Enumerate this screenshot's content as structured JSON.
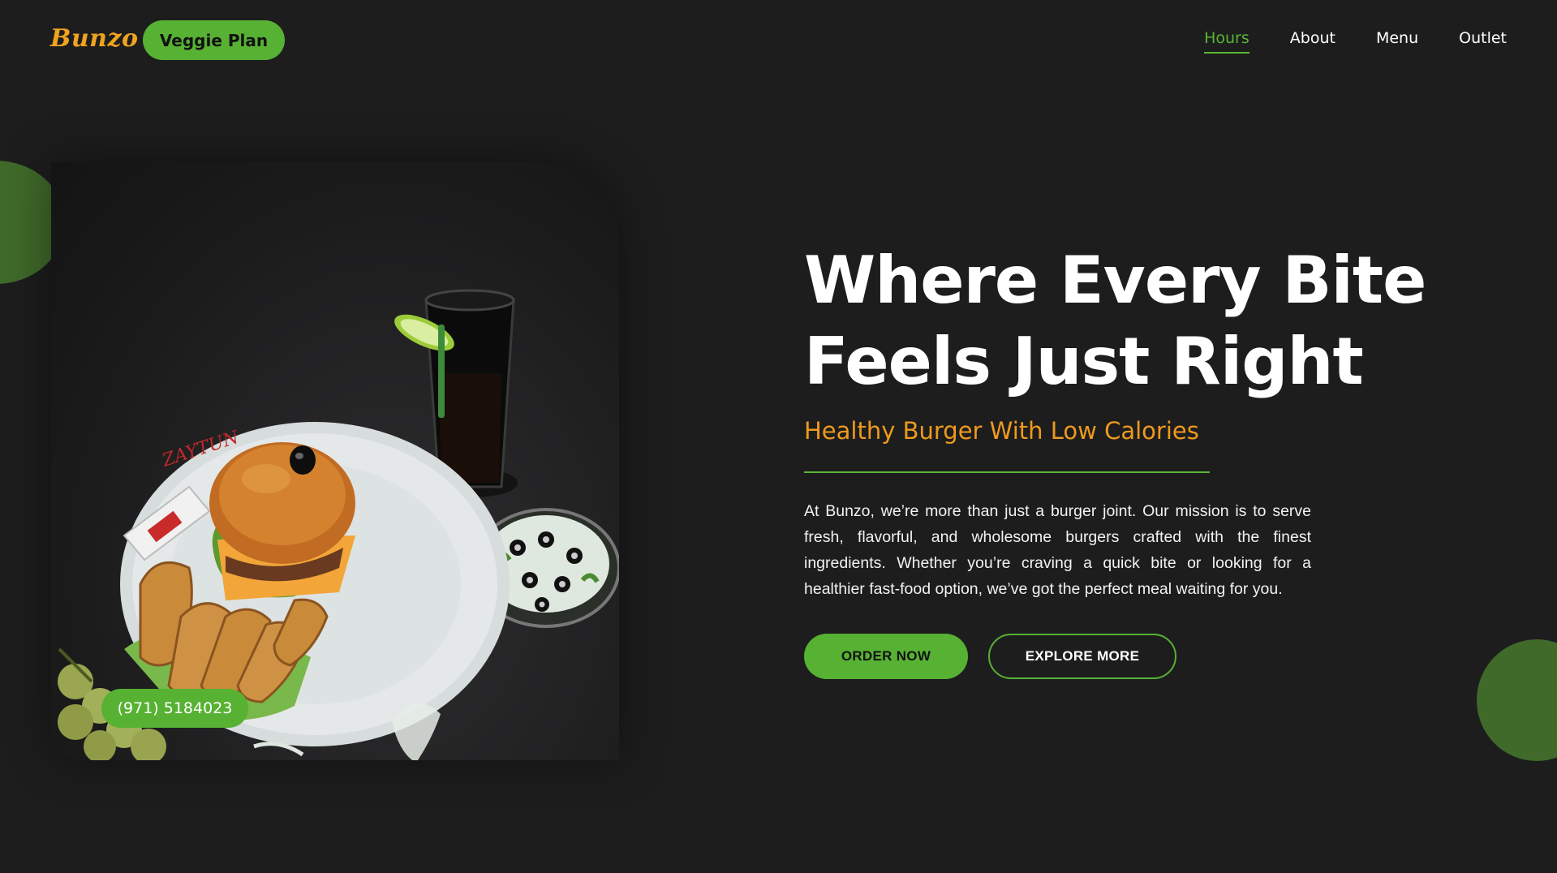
{
  "brand": {
    "logo_text": "Bunzo",
    "veggie_button": "Veggie Plan"
  },
  "nav": {
    "items": [
      {
        "label": "Hours",
        "active": true
      },
      {
        "label": "About",
        "active": false
      },
      {
        "label": "Menu",
        "active": false
      },
      {
        "label": "Outlet",
        "active": false
      }
    ]
  },
  "hero": {
    "headline_line1": "Where Every Bite",
    "headline_line2": "Feels Just Right",
    "subtitle": "Healthy Burger With Low Calories",
    "description": "At Bunzo, we’re more than just a burger joint. Our mission is to serve fresh, flavorful, and wholesome burgers crafted with the finest ingredients. Whether you’re craving a quick bite or looking for a healthier fast-food option, we’ve got the perfect meal waiting for you.",
    "order_button": "ORDER NOW",
    "explore_button": "EXPLORE MORE",
    "phone": "(971) 5184023",
    "image_plate_text": "ZAYTUN"
  },
  "colors": {
    "background": "#1d1d1e",
    "accent_green": "#57b133",
    "accent_orange": "#ee9a1c",
    "deco_green": "#3f6a2a"
  }
}
